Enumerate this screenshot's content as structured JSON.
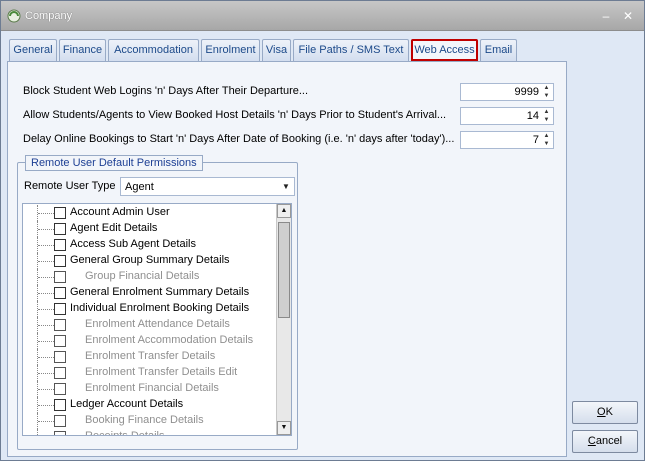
{
  "window": {
    "title": "Company",
    "minimize_icon": "minimize-icon",
    "close_icon": "close-icon"
  },
  "tabs": [
    {
      "label": "General"
    },
    {
      "label": "Finance"
    },
    {
      "label": "Accommodation"
    },
    {
      "label": "Enrolment"
    },
    {
      "label": "Visa"
    },
    {
      "label": "File Paths / SMS Text"
    },
    {
      "label": "Web Access",
      "active": true
    },
    {
      "label": "Email"
    }
  ],
  "fields": [
    {
      "label": "Block Student Web Logins 'n' Days After Their Departure...",
      "value": "9999"
    },
    {
      "label": "Allow Students/Agents to View Booked Host Details 'n' Days Prior to Student's Arrival...",
      "value": "14"
    },
    {
      "label": "Delay Online Bookings to Start 'n' Days After Date of Booking (i.e. 'n' days after 'today')...",
      "value": "7"
    }
  ],
  "permissions": {
    "group_title": "Remote User Default Permissions",
    "type_label": "Remote User Type",
    "type_value": "Agent",
    "items": [
      {
        "label": "Account Admin User",
        "level": 0,
        "enabled": true
      },
      {
        "label": "Agent Edit Details",
        "level": 0,
        "enabled": true
      },
      {
        "label": "Access Sub Agent Details",
        "level": 0,
        "enabled": true
      },
      {
        "label": "General Group Summary Details",
        "level": 0,
        "enabled": true
      },
      {
        "label": "Group Financial Details",
        "level": 1,
        "enabled": false
      },
      {
        "label": "General Enrolment Summary Details",
        "level": 0,
        "enabled": true
      },
      {
        "label": "Individual Enrolment Booking Details",
        "level": 0,
        "enabled": true
      },
      {
        "label": "Enrolment Attendance Details",
        "level": 1,
        "enabled": false
      },
      {
        "label": "Enrolment Accommodation Details",
        "level": 1,
        "enabled": false
      },
      {
        "label": "Enrolment Transfer Details",
        "level": 1,
        "enabled": false
      },
      {
        "label": "Enrolment Transfer Details Edit",
        "level": 1,
        "enabled": false
      },
      {
        "label": "Enrolment Financial Details",
        "level": 1,
        "enabled": false
      },
      {
        "label": "Ledger Account Details",
        "level": 0,
        "enabled": true
      },
      {
        "label": "Booking Finance Details",
        "level": 1,
        "enabled": false
      },
      {
        "label": "Receipts Details",
        "level": 1,
        "enabled": false
      }
    ]
  },
  "buttons": {
    "ok": {
      "accel": "O",
      "rest": "K"
    },
    "cancel": {
      "accel": "C",
      "rest": "ancel"
    }
  },
  "colors": {
    "active_tab_outline": "#c00000",
    "disabled_text": "#8f8f8f",
    "group_title": "#1d3f94"
  }
}
